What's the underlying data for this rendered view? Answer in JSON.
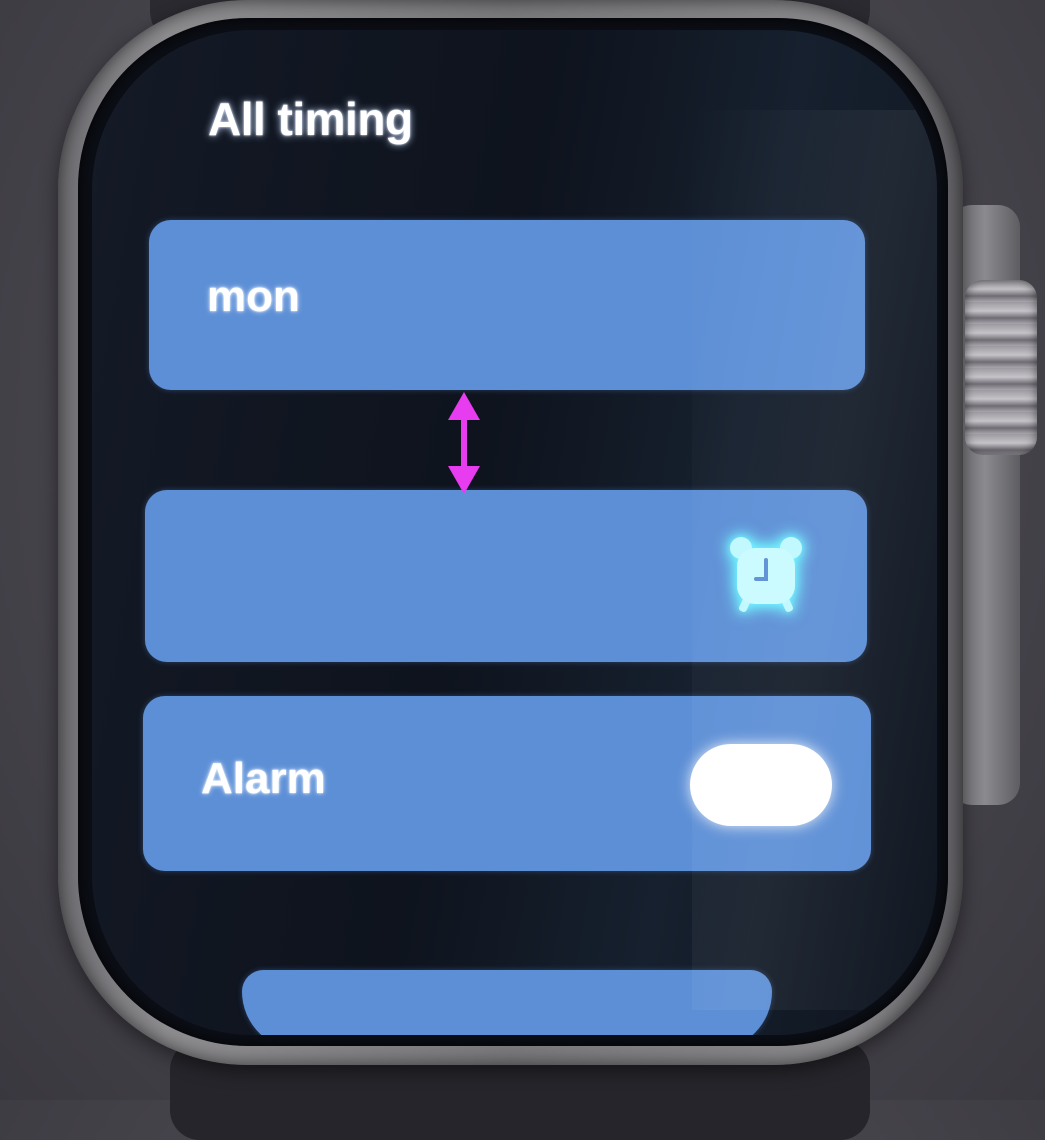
{
  "header": {
    "title": "All timing"
  },
  "list": {
    "items": [
      {
        "label": "mon"
      },
      {
        "label": "",
        "icon": "alarm-clock-icon"
      },
      {
        "label": "Alarm",
        "toggle": {
          "state": "on"
        }
      }
    ]
  },
  "colors": {
    "card": "#5d8fd6",
    "icon_glow": "#5ef2ff",
    "annotation_arrow": "#e83cf0"
  }
}
